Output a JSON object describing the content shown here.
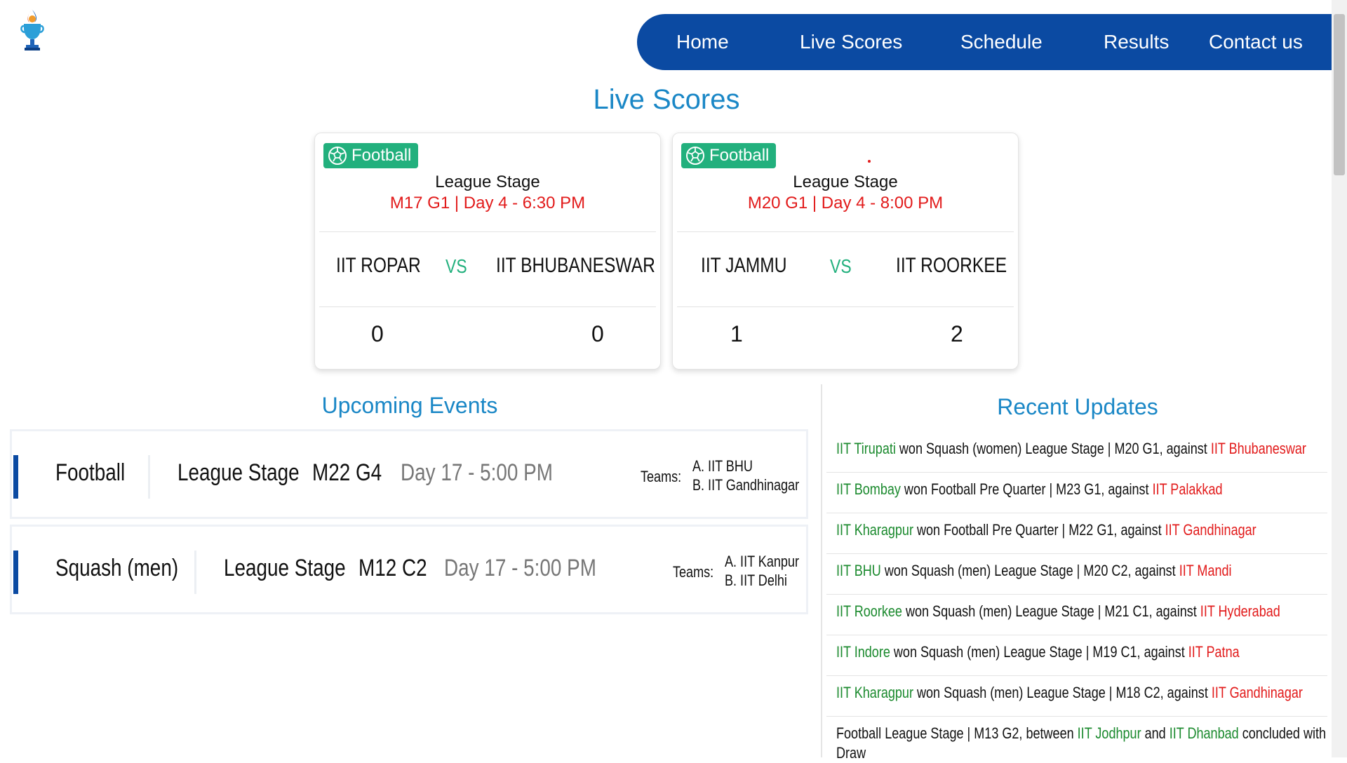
{
  "nav": {
    "items": [
      "Home",
      "Live Scores",
      "Schedule",
      "Results",
      "Contact us"
    ]
  },
  "live": {
    "title": "Live Scores",
    "matches": [
      {
        "sport": "Football",
        "stage": "League Stage",
        "when": "M17 G1 | Day 4 - 6:30 PM",
        "team_a": "IIT ROPAR",
        "vs": "VS",
        "team_b": "IIT BHUBANESWAR",
        "score_a": "0",
        "score_b": "0"
      },
      {
        "sport": "Football",
        "stage": "League Stage",
        "when": "M20 G1 | Day 4 - 8:00 PM",
        "team_a": "IIT JAMMU",
        "vs": "VS",
        "team_b": "IIT ROORKEE",
        "score_a": "1",
        "score_b": "2"
      }
    ]
  },
  "upcoming": {
    "title": "Upcoming Events",
    "events": [
      {
        "sport": "Football",
        "stage": "League Stage",
        "match": "M22 G4",
        "time": "Day 17 - 5:00 PM",
        "teams_label": "Teams:",
        "team_a": "A. IIT BHU",
        "team_b": "B. IIT Gandhinagar"
      },
      {
        "sport": "Squash (men)",
        "stage": "League Stage",
        "match": "M12 C2",
        "time": "Day 17 - 5:00 PM",
        "teams_label": "Teams:",
        "team_a": "A. IIT Kanpur",
        "team_b": "B. IIT Delhi"
      }
    ]
  },
  "recent": {
    "title": "Recent Updates",
    "items": [
      {
        "winner": "IIT Tirupati",
        "text": " won Squash (women) League Stage | M20 G1, against ",
        "loser": "IIT Bhubaneswar"
      },
      {
        "winner": "IIT Bombay",
        "text": " won Football Pre Quarter | M23 G1, against ",
        "loser": "IIT Palakkad"
      },
      {
        "winner": "IIT Kharagpur",
        "text": " won Football Pre Quarter | M22 G1, against ",
        "loser": "IIT Gandhinagar"
      },
      {
        "winner": "IIT BHU",
        "text": " won Squash (men) League Stage | M20 C2, against ",
        "loser": "IIT Mandi"
      },
      {
        "winner": "IIT Roorkee",
        "text": " won Squash (men) League Stage | M21 C1, against ",
        "loser": "IIT Hyderabad"
      },
      {
        "winner": "IIT Indore",
        "text": " won Squash (men) League Stage | M19 C1, against ",
        "loser": "IIT Patna"
      },
      {
        "winner": "IIT Kharagpur",
        "text": " won Squash (men) League Stage | M18 C2, against ",
        "loser": "IIT Gandhinagar"
      }
    ],
    "draw": {
      "prefix": "Football League Stage | M13 G2, between ",
      "team_a": "IIT Jodhpur",
      "joiner": " and ",
      "team_b": "IIT Dhanbad",
      "suffix": " concluded with a Draw"
    }
  },
  "colors": {
    "nav_bg": "#0b4aa2",
    "title_blue": "#1a87c6",
    "badge_green": "#22b07d",
    "winner_green": "#1b8a2e",
    "accent_red": "#e21b1b"
  }
}
